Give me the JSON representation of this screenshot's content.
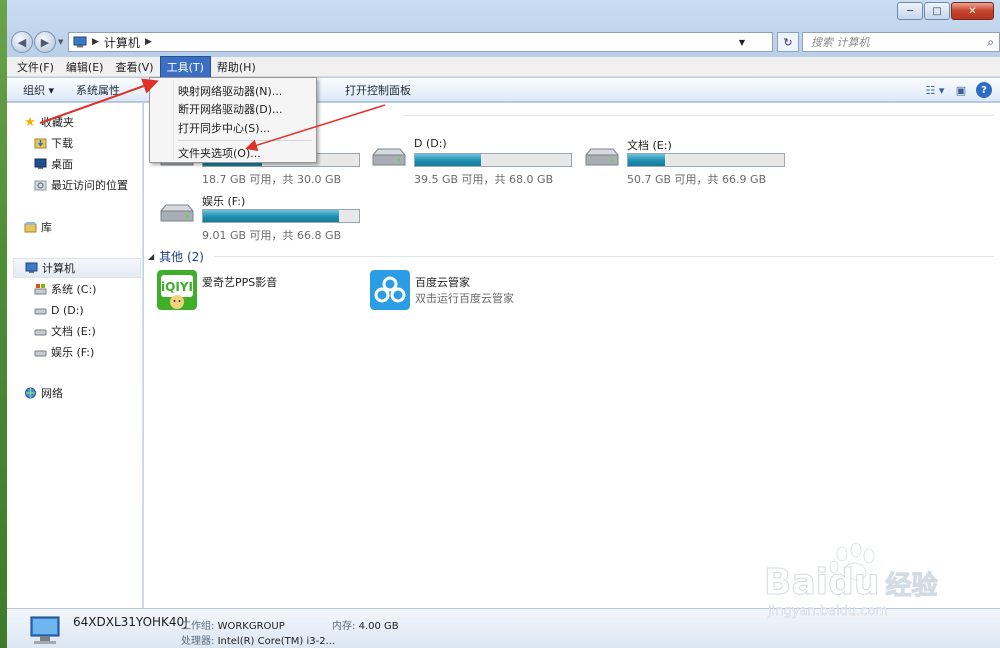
{
  "window": {
    "caption": {
      "min": "─",
      "max": "□",
      "close": "✕"
    }
  },
  "nav": {
    "back": "◀",
    "forward": "▶",
    "breadcrumb": [
      "计算机"
    ],
    "search_placeholder": "搜索 计算机",
    "refresh": "↻"
  },
  "menubar": [
    {
      "label": "文件(F)"
    },
    {
      "label": "编辑(E)"
    },
    {
      "label": "查看(V)"
    },
    {
      "label": "工具(T)",
      "active": true
    },
    {
      "label": "帮助(H)"
    }
  ],
  "toolbar": {
    "organize": "组织 ▾",
    "system_properties": "系统属性",
    "open_control_panel": "打开控制面板"
  },
  "tools_menu": [
    "映射网络驱动器(N)...",
    "断开网络驱动器(D)...",
    "打开同步中心(S)...",
    "文件夹选项(O)..."
  ],
  "sidebar": {
    "favorites": "收藏夹",
    "downloads": "下载",
    "desktop": "桌面",
    "recent": "最近访问的位置",
    "library": "库",
    "computer": "计算机",
    "drive_c": "系统 (C:)",
    "drive_d": "D (D:)",
    "drive_e": "文档 (E:)",
    "drive_f": "娱乐 (F:)",
    "network": "网络"
  },
  "drives": [
    {
      "name": "",
      "info": "18.7 GB 可用，共 30.0 GB",
      "used_fraction": 0.38
    },
    {
      "name": "D (D:)",
      "info": "39.5 GB 可用，共 68.0 GB",
      "used_fraction": 0.42
    },
    {
      "name": "文档 (E:)",
      "info": "50.7 GB 可用，共 66.9 GB",
      "used_fraction": 0.24
    },
    {
      "name": "娱乐 (F:)",
      "info": "9.01 GB 可用，共 66.8 GB",
      "used_fraction": 0.87
    }
  ],
  "other_group": "其他 (2)",
  "apps": [
    {
      "name": "爱奇艺PPS影音",
      "desc": ""
    },
    {
      "name": "百度云管家",
      "desc": "双击运行百度云管家"
    }
  ],
  "details": {
    "computer_name": "64XDXL31YOHK40J",
    "workgroup_label": "工作组:",
    "workgroup": "WORKGROUP",
    "memory_label": "内存:",
    "memory": "4.00 GB",
    "cpu_label": "处理器:",
    "cpu": "Intel(R) Core(TM) i3-2..."
  },
  "watermark": {
    "brand": "Bai",
    "brand2": "du",
    "cn": "经验",
    "url": "jingyan.baidu.com"
  },
  "colors": {
    "accent": "#3a6fc4",
    "drive_fill": "#1f8eb0",
    "annotation": "#e0302a"
  }
}
